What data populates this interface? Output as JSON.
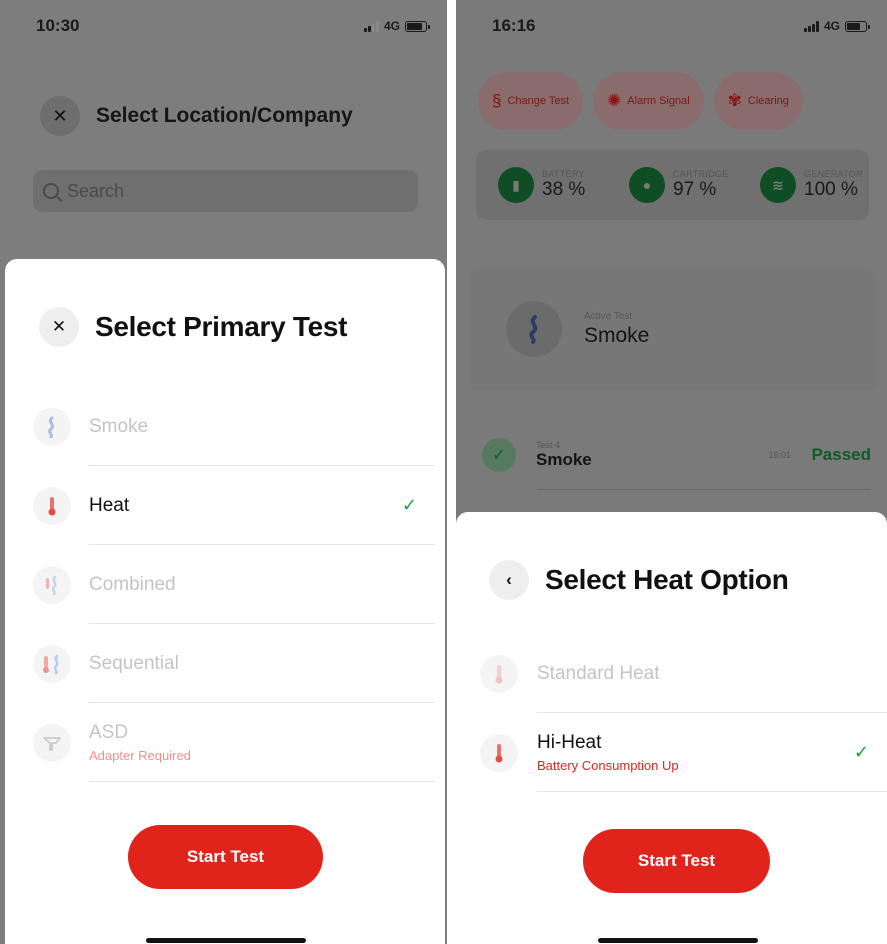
{
  "left_screen": {
    "status": {
      "time": "10:30",
      "network": "4G"
    },
    "background": {
      "title": "Select Location/Company",
      "search_placeholder": "Search"
    },
    "sheet": {
      "title": "Select Primary Test",
      "options": [
        {
          "name": "Smoke",
          "sub": "",
          "enabled": false,
          "selected": false,
          "icon": "smoke-icon"
        },
        {
          "name": "Heat",
          "sub": "",
          "enabled": true,
          "selected": true,
          "icon": "thermometer-icon"
        },
        {
          "name": "Combined",
          "sub": "",
          "enabled": false,
          "selected": false,
          "icon": "combined-icon"
        },
        {
          "name": "Sequential",
          "sub": "",
          "enabled": false,
          "selected": false,
          "icon": "sequential-icon"
        },
        {
          "name": "ASD",
          "sub": "Adapter Required",
          "enabled": false,
          "selected": false,
          "icon": "asd-adapter-icon"
        }
      ],
      "button_label": "Start Test"
    }
  },
  "right_screen": {
    "status": {
      "time": "16:16",
      "network": "4G"
    },
    "background": {
      "chips": [
        {
          "label": "Change Test",
          "icon": "smoke-icon"
        },
        {
          "label": "Alarm Signal",
          "icon": "sun-icon"
        },
        {
          "label": "Clearing",
          "icon": "fan-icon"
        }
      ],
      "stats": [
        {
          "label": "BATTERY",
          "value": "38 %",
          "icon": "battery-icon"
        },
        {
          "label": "CARTRIDGE",
          "value": "97 %",
          "icon": "drop-icon"
        },
        {
          "label": "GENERATOR",
          "value": "100 %",
          "icon": "generator-icon"
        }
      ],
      "active_test": {
        "label": "Active Test",
        "name": "Smoke"
      },
      "last_test": {
        "number": "Test 4",
        "name": "Smoke",
        "time": "16:01",
        "status": "Passed"
      }
    },
    "sheet": {
      "title": "Select Heat Option",
      "options": [
        {
          "name": "Standard Heat",
          "sub": "",
          "enabled": false,
          "selected": false,
          "icon": "thermometer-icon"
        },
        {
          "name": "Hi-Heat",
          "sub": "Battery Consumption Up",
          "enabled": true,
          "selected": true,
          "icon": "thermometer-icon"
        }
      ],
      "button_label": "Start Test"
    }
  },
  "colors": {
    "accent": "#e0241c",
    "success": "#1e9e3a",
    "disabled_text": "#c4c4c4",
    "warning_text": "#e02424"
  }
}
